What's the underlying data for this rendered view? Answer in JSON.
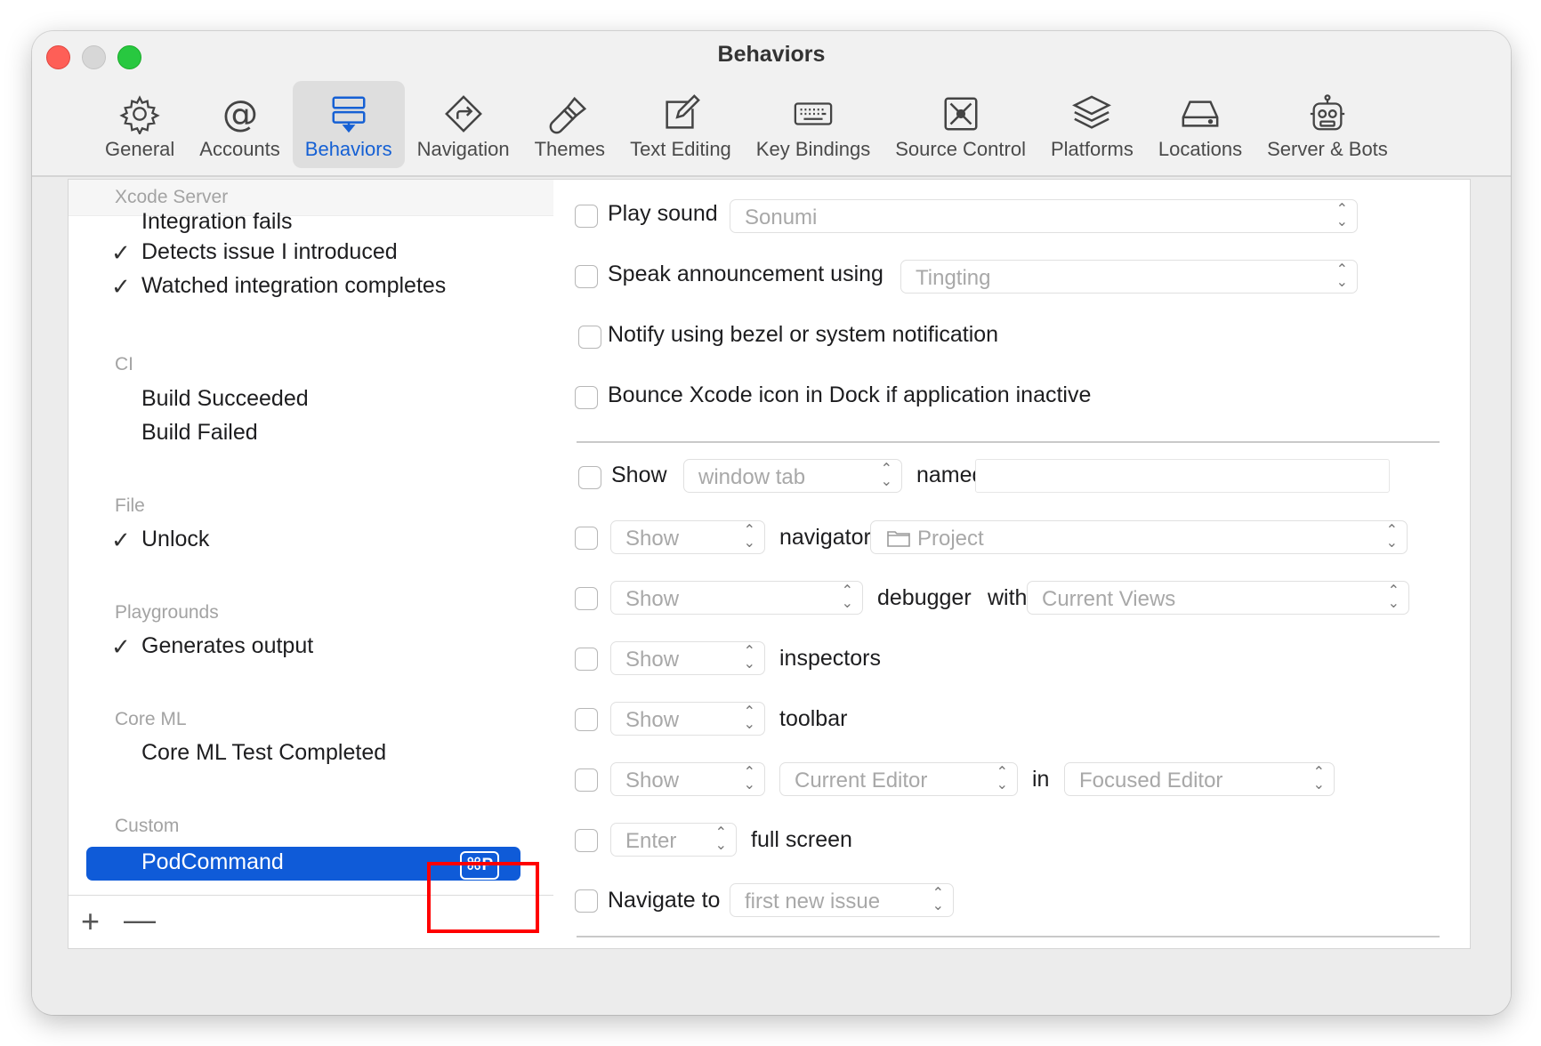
{
  "window": {
    "title": "Behaviors"
  },
  "toolbar": {
    "tabs": [
      {
        "label": "General",
        "icon": "gear-icon"
      },
      {
        "label": "Accounts",
        "icon": "at-icon"
      },
      {
        "label": "Behaviors",
        "icon": "behaviors-icon",
        "selected": true
      },
      {
        "label": "Navigation",
        "icon": "navigation-icon"
      },
      {
        "label": "Themes",
        "icon": "brush-icon"
      },
      {
        "label": "Text Editing",
        "icon": "edit-icon"
      },
      {
        "label": "Key Bindings",
        "icon": "keyboard-icon"
      },
      {
        "label": "Source Control",
        "icon": "source-control-icon"
      },
      {
        "label": "Platforms",
        "icon": "layers-icon"
      },
      {
        "label": "Locations",
        "icon": "drive-icon"
      },
      {
        "label": "Server & Bots",
        "icon": "robot-icon"
      }
    ]
  },
  "sidebar": {
    "groups": [
      {
        "title": "Xcode Server",
        "items": [
          {
            "label": "Integration fails",
            "checked": false
          },
          {
            "label": "Detects issue I introduced",
            "checked": true
          },
          {
            "label": "Watched integration completes",
            "checked": true
          }
        ]
      },
      {
        "title": "CI",
        "items": [
          {
            "label": "Build Succeeded",
            "checked": false
          },
          {
            "label": "Build Failed",
            "checked": false
          }
        ]
      },
      {
        "title": "File",
        "items": [
          {
            "label": "Unlock",
            "checked": true
          }
        ]
      },
      {
        "title": "Playgrounds",
        "items": [
          {
            "label": "Generates output",
            "checked": true
          }
        ]
      },
      {
        "title": "Core ML",
        "items": [
          {
            "label": "Core ML Test Completed",
            "checked": false
          }
        ]
      },
      {
        "title": "Custom",
        "items": [
          {
            "label": "PodCommand",
            "checked": false,
            "selected": true,
            "shortcut": "⌘P"
          }
        ]
      }
    ],
    "check_glyph": "✓",
    "add_label": "+",
    "remove_label": "—"
  },
  "settings": {
    "play_sound": {
      "label": "Play sound",
      "value": "Sonumi"
    },
    "speak": {
      "label": "Speak announcement using",
      "value": "Tingting"
    },
    "notify": {
      "label": "Notify using bezel or system notification"
    },
    "bounce": {
      "label": "Bounce Xcode icon in Dock if application inactive"
    },
    "show_tab": {
      "label": "Show",
      "value": "window tab",
      "named": "named",
      "name_value": ""
    },
    "navigator": {
      "value": "Show",
      "label": "navigator",
      "target": "Project"
    },
    "debugger": {
      "value": "Show",
      "label": "debugger",
      "with": "with",
      "target": "Current Views"
    },
    "inspectors": {
      "value": "Show",
      "label": "inspectors"
    },
    "toolbar_row": {
      "value": "Show",
      "label": "toolbar"
    },
    "editor": {
      "value": "Show",
      "which": "Current Editor",
      "in": "in",
      "where": "Focused Editor"
    },
    "fullscreen": {
      "value": "Enter",
      "label": "full screen"
    },
    "navigate": {
      "label": "Navigate to",
      "value": "first new issue"
    }
  }
}
